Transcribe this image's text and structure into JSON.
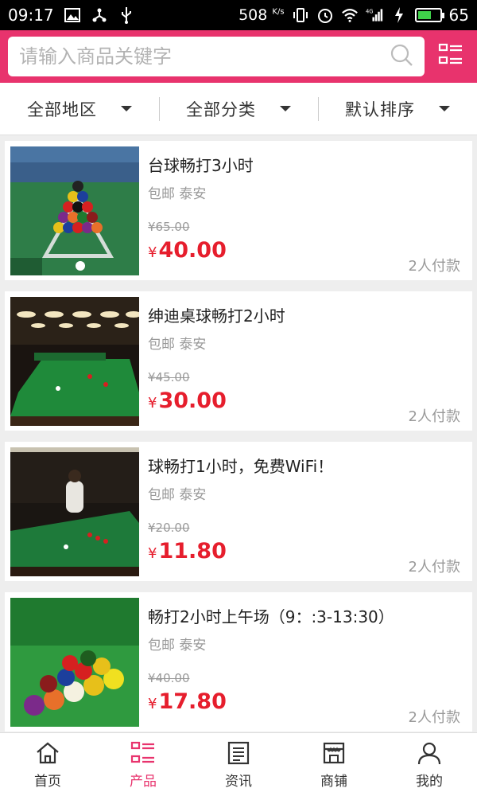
{
  "status_bar": {
    "time": "09:17",
    "net_speed": "508",
    "net_speed_unit": "K/s",
    "signal_label": "4G",
    "battery": "65"
  },
  "search": {
    "placeholder": "请输入商品关键字",
    "icon": "search-icon",
    "menu_icon": "list-menu-icon"
  },
  "filters": [
    {
      "label": "全部地区"
    },
    {
      "label": "全部分类"
    },
    {
      "label": "默认排序"
    }
  ],
  "products": [
    {
      "title": "台球畅打3小时",
      "tags": "包邮 泰安",
      "old_price": "¥65.00",
      "currency": "¥",
      "price": "40.00",
      "sales": "2人付款"
    },
    {
      "title": "绅迪桌球畅打2小时",
      "tags": "包邮 泰安",
      "old_price": "¥45.00",
      "currency": "¥",
      "price": "30.00",
      "sales": "2人付款"
    },
    {
      "title": "球畅打1小时，免费WiFi！",
      "tags": "包邮 泰安",
      "old_price": "¥20.00",
      "currency": "¥",
      "price": "11.80",
      "sales": "2人付款"
    },
    {
      "title": "畅打2小时上午场（9：:3-13:30）",
      "tags": "包邮 泰安",
      "old_price": "¥40.00",
      "currency": "¥",
      "price": "17.80",
      "sales": "2人付款"
    }
  ],
  "nav": [
    {
      "label": "首页",
      "icon": "home-icon"
    },
    {
      "label": "产品",
      "icon": "product-list-icon"
    },
    {
      "label": "资讯",
      "icon": "news-icon"
    },
    {
      "label": "商铺",
      "icon": "store-icon"
    },
    {
      "label": "我的",
      "icon": "user-icon"
    }
  ],
  "colors": {
    "brand": "#e8336d",
    "price": "#e61e2d",
    "muted": "#999999"
  }
}
